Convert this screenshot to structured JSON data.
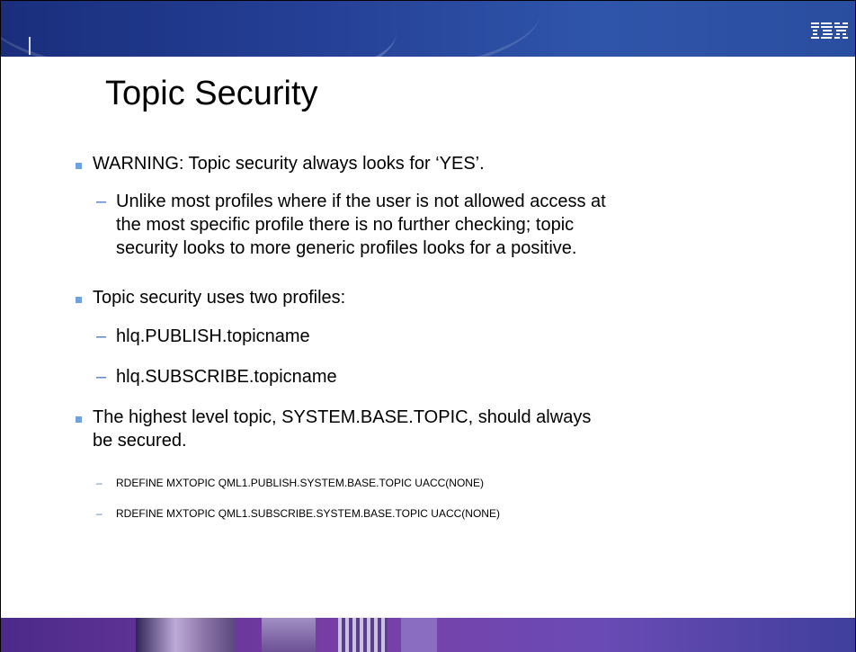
{
  "header": {
    "logo_text": "IBM"
  },
  "slide": {
    "title": "Topic Security",
    "bullets": [
      {
        "text": "WARNING:  Topic security always looks for ‘YES’."
      },
      {
        "sub": [
          "Unlike most profiles where if the user is not allowed access at",
          "the most specific profile there is no further checking; topic",
          "security looks to more generic profiles looks for a positive."
        ]
      },
      {
        "text": "Topic security uses two profiles:"
      },
      {
        "sub": [
          "hlq.PUBLISH.topicname"
        ]
      },
      {
        "sub": [
          "hlq.SUBSCRIBE.topicname"
        ]
      },
      {
        "text": [
          "The highest level topic, SYSTEM.BASE.TOPIC, should always",
          "be secured."
        ]
      },
      {
        "sub": [
          "RDEFINE MXTOPIC QML1.PUBLISH.SYSTEM.BASE.TOPIC  UACC(NONE)"
        ]
      },
      {
        "sub": [
          "RDEFINE MXTOPIC QML1.SUBSCRIBE.SYSTEM.BASE.TOPIC  UACC(NONE)"
        ]
      }
    ],
    "dash": "–"
  },
  "colors": {
    "header_blue": "#243f95",
    "bullet_blue": "#6fa0e0",
    "footer_purple": "#7a3ea6"
  }
}
